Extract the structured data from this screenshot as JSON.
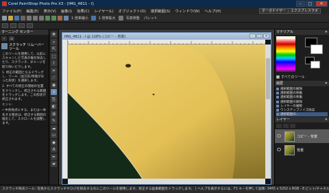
{
  "window": {
    "title": "Corel PaintShop Photo Pro X3 - [IMG_4811 - I]",
    "min": "–",
    "max": "□",
    "close": "✕"
  },
  "menu": [
    "ファイル(F)",
    "編集(E)",
    "表示(V)",
    "画像(I)",
    "効果(C)",
    "レイヤー(L)",
    "オブジェクト(O)",
    "選択範囲(S)",
    "ウィンドウ(W)",
    "ヘルプ(H)"
  ],
  "workspace": {
    "organizer": "オーガナイザー",
    "express_lab": "エクスプレスラボ"
  },
  "toolbar": {
    "zoom1": "1 倍率縮小",
    "zoom2": "1 倍率拡大",
    "combo": "写真修整",
    "palette": "パレット"
  },
  "learning": {
    "header": "ラーニング センター",
    "back": "‹",
    "home": "⌂",
    "topic": "スクラッチ リムーバー ツール",
    "para1": "このツールを使用して、以前にスキャンした写真の傷を除去したり、スクラッチ、ダメージを取り除いたりします。",
    "step1": "1. 修正の範囲となるドラッグし、ツール（長方形/両端が尖った形状）を選択します。",
    "step2": "2. すべての修正の開始の位置をクリックし、修正される範囲をドラッグします。この形状が修正されます。",
    "hint_label": "ヒント:",
    "hint": "• 中央地点にする、または一体化する場合は、修正する範囲の幅をして、スクロールを調整します。"
  },
  "document": {
    "title": "IMG_4811 - I @ 128% (コピー - 背景)",
    "min": "–",
    "max": "□",
    "close": "✕"
  },
  "materials": {
    "header": "マテリアル",
    "all_materials": "すべてのツール"
  },
  "history": {
    "header": "履歴",
    "items": [
      "選択範囲の解除",
      "選択範囲の移動",
      "選択範囲の移動",
      "選択範囲の解除",
      "レイヤーの複製",
      "ワンステップノイズ除去",
      "選択範囲の..."
    ]
  },
  "layers": {
    "header": "レイヤー",
    "items": [
      {
        "name": "コピー - 背景"
      },
      {
        "name": "背景"
      }
    ]
  },
  "status": {
    "left": "スクラッチ除去ツール: 写真からスクラッチやひびを除去するのにこのツールを使用します。修正する画素範囲をドラッグします。 ( ヘルプを表示するには、F1 キーを押して",
    "right": "画像: 3465 x 5202 x RGB - 8 ビット/チャネル"
  },
  "colors": {
    "titlebar": "#0e2a4a",
    "accent": "#6a86b0",
    "photo_yellow": "#e7c65a"
  }
}
